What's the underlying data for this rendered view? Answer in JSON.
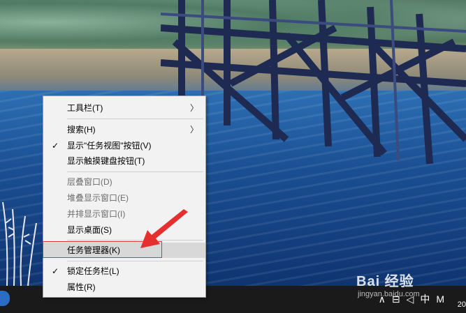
{
  "context_menu": {
    "items": [
      {
        "label": "工具栏(T)",
        "checked": false,
        "submenu": true,
        "disabled": false
      },
      {
        "label": "搜索(H)",
        "checked": false,
        "submenu": true,
        "disabled": false
      },
      {
        "label": "显示\"任务视图\"按钮(V)",
        "checked": true,
        "submenu": false,
        "disabled": false
      },
      {
        "label": "显示触摸键盘按钮(T)",
        "checked": false,
        "submenu": false,
        "disabled": false
      },
      {
        "label": "层叠窗口(D)",
        "checked": false,
        "submenu": false,
        "disabled": true
      },
      {
        "label": "堆叠显示窗口(E)",
        "checked": false,
        "submenu": false,
        "disabled": true
      },
      {
        "label": "并排显示窗口(I)",
        "checked": false,
        "submenu": false,
        "disabled": true
      },
      {
        "label": "显示桌面(S)",
        "checked": false,
        "submenu": false,
        "disabled": false
      },
      {
        "label": "任务管理器(K)",
        "checked": false,
        "submenu": false,
        "disabled": false,
        "highlighted": true
      },
      {
        "label": "锁定任务栏(L)",
        "checked": true,
        "submenu": false,
        "disabled": false
      },
      {
        "label": "属性(R)",
        "checked": false,
        "submenu": false,
        "disabled": false
      }
    ],
    "check_glyph": "✓",
    "arrow_glyph": "〉"
  },
  "watermark": {
    "brand": "Bai 经验",
    "site": "jingyan.baidu.com"
  },
  "taskbar": {
    "tray_icons": [
      "chevron-up-icon",
      "network-icon",
      "volume-icon",
      "input-method-icon",
      "ime-mode-icon",
      "notification-icon"
    ],
    "tray_glyphs": [
      "∧",
      "⊟",
      "◁",
      "中",
      "M"
    ],
    "clock_partial": "20"
  },
  "colors": {
    "highlight_box": "#e63030",
    "menu_bg": "#f2f2f2",
    "taskbar": "#1a1a1a"
  }
}
